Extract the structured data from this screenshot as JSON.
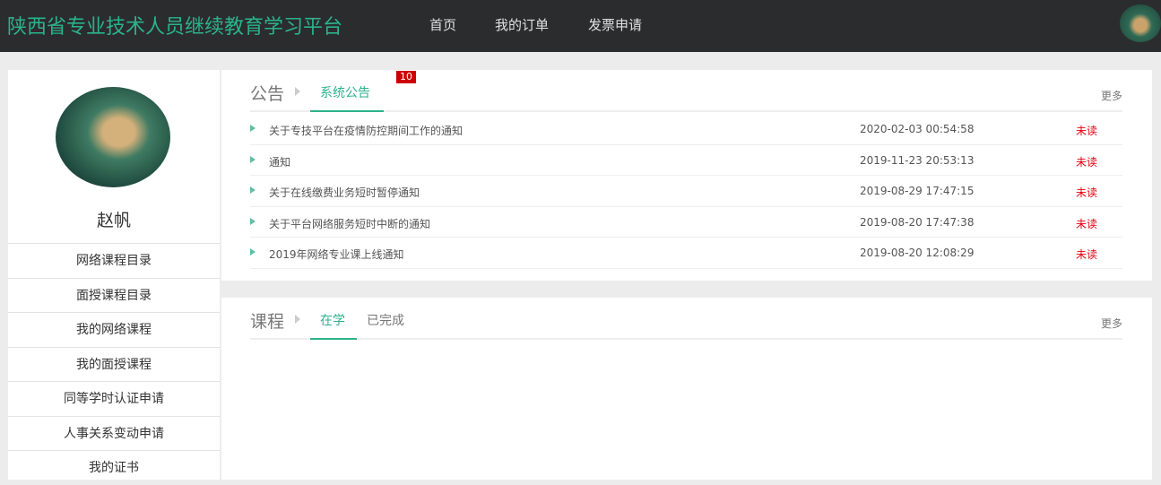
{
  "header": {
    "title": "陕西省专业技术人员继续教育学习平台",
    "nav": [
      "首页",
      "我的订单",
      "发票申请"
    ]
  },
  "sidebar": {
    "user_name": "赵帆",
    "items": [
      "网络课程目录",
      "面授课程目录",
      "我的网络课程",
      "我的面授课程",
      "同等学时认证申请",
      "人事关系变动申请",
      "我的证书"
    ]
  },
  "notices": {
    "title": "公告",
    "tab": "系统公告",
    "badge": "10",
    "more": "更多",
    "rows": [
      {
        "title": "关于专技平台在疫情防控期间工作的通知",
        "date": "2020-02-03 00:54:58",
        "status": "未读"
      },
      {
        "title": "通知",
        "date": "2019-11-23 20:53:13",
        "status": "未读"
      },
      {
        "title": "关于在线缴费业务短时暂停通知",
        "date": "2019-08-29 17:47:15",
        "status": "未读"
      },
      {
        "title": "关于平台网络服务短时中断的通知",
        "date": "2019-08-20 17:47:38",
        "status": "未读"
      },
      {
        "title": "2019年网络专业课上线通知",
        "date": "2019-08-20 12:08:29",
        "status": "未读"
      }
    ]
  },
  "courses": {
    "title": "课程",
    "tabs": [
      "在学",
      "已完成"
    ],
    "more": "更多"
  }
}
